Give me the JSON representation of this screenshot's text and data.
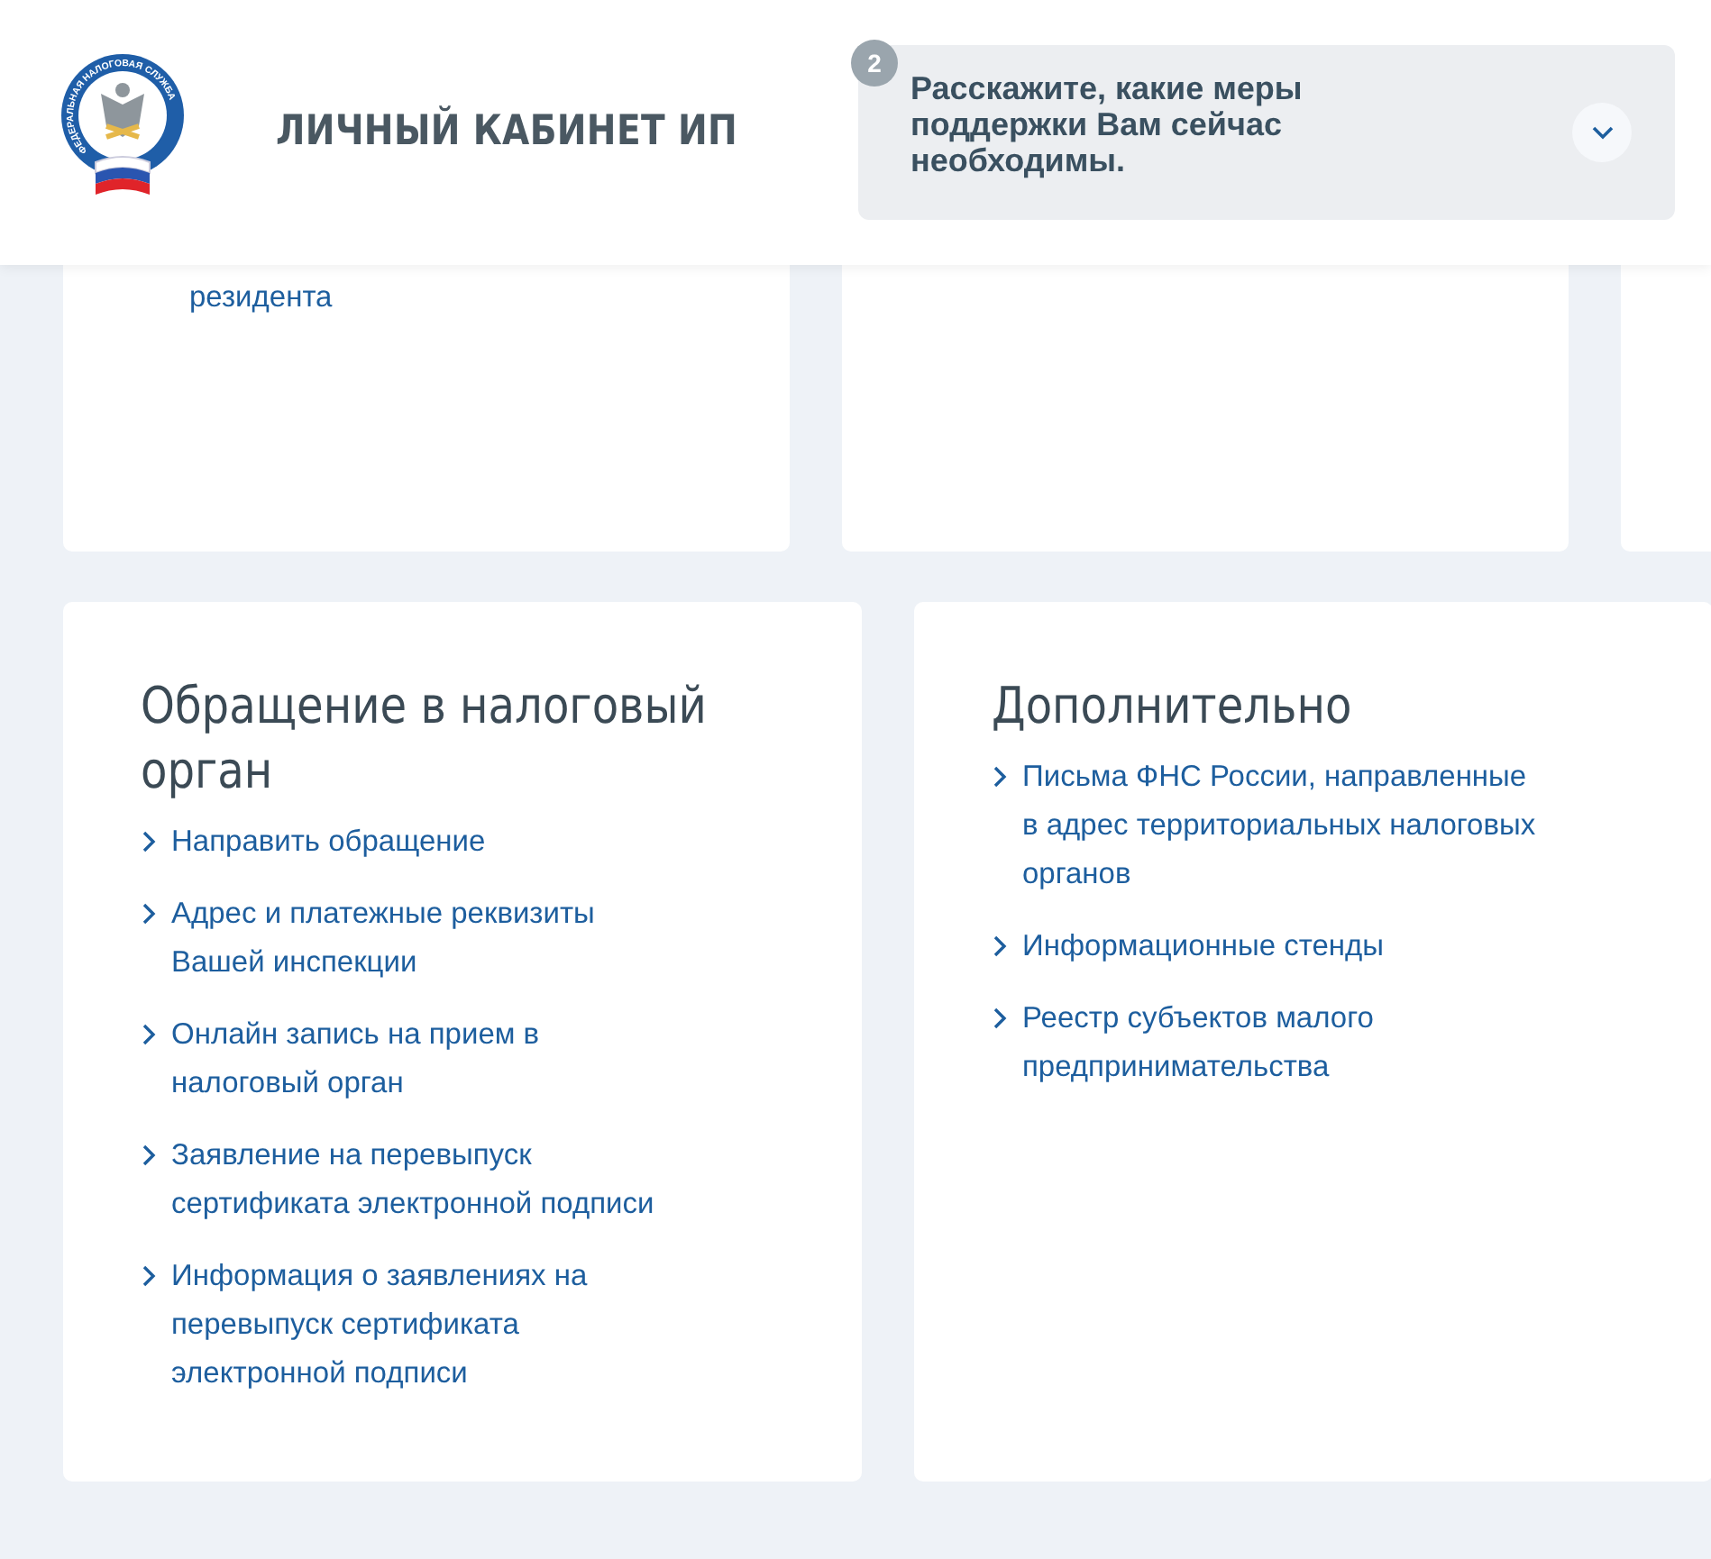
{
  "header": {
    "logo_text": "ФЕДЕРАЛЬНАЯ НАЛОГОВАЯ СЛУЖБА",
    "title": "ЛИЧНЫЙ КАБИНЕТ ИП",
    "notice": {
      "badge": "2",
      "text": "Расскажите, какие меры поддержки Вам сейчас необходимы.",
      "expanded": false
    }
  },
  "top_cards": [
    {
      "kind": "text",
      "text": "резидента"
    },
    {
      "kind": "empty"
    },
    {
      "kind": "empty"
    }
  ],
  "sections": [
    {
      "title": "Обращение в налоговый орган",
      "links": [
        "Направить обращение",
        "Адрес и платежные реквизиты Вашей инспекции",
        "Онлайн запись на прием в налоговый орган",
        "Заявление на перевыпуск сертификата электронной подписи",
        "Информация о заявлениях на перевыпуск сертификата электронной подписи"
      ]
    },
    {
      "title": "Дополнительно",
      "links": [
        "Письма ФНС России, направленные в адрес территориальных налоговых органов",
        "Информационные стенды",
        "Реестр субъектов малого предпринимательства"
      ]
    }
  ]
}
